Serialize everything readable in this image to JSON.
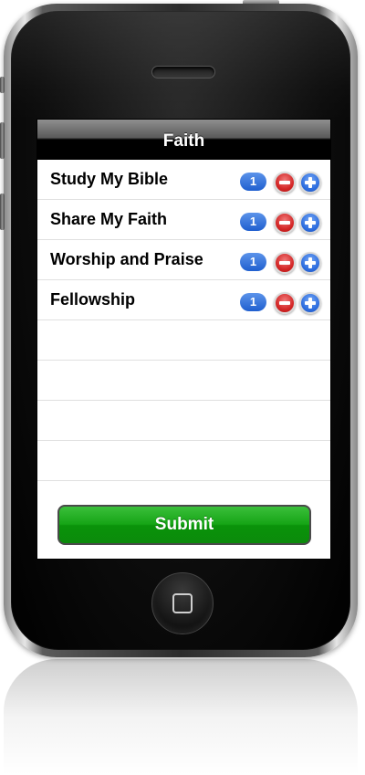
{
  "screen": {
    "title": "Faith"
  },
  "items": [
    {
      "label": "Study My Bible",
      "count": "1"
    },
    {
      "label": "Share My Faith",
      "count": "1"
    },
    {
      "label": "Worship and Praise",
      "count": "1"
    },
    {
      "label": "Fellowship",
      "count": "1"
    }
  ],
  "empty_rows": 4,
  "submit": {
    "label": "Submit"
  },
  "colors": {
    "submit_green": "#16a516",
    "badge_blue": "#1f5fcf",
    "minus_red": "#d42727",
    "plus_blue": "#2f6fe0",
    "navbar": "#000000"
  },
  "icons": {
    "minus": "minus-circle-icon",
    "plus": "plus-circle-icon",
    "home": "home-square-icon"
  }
}
